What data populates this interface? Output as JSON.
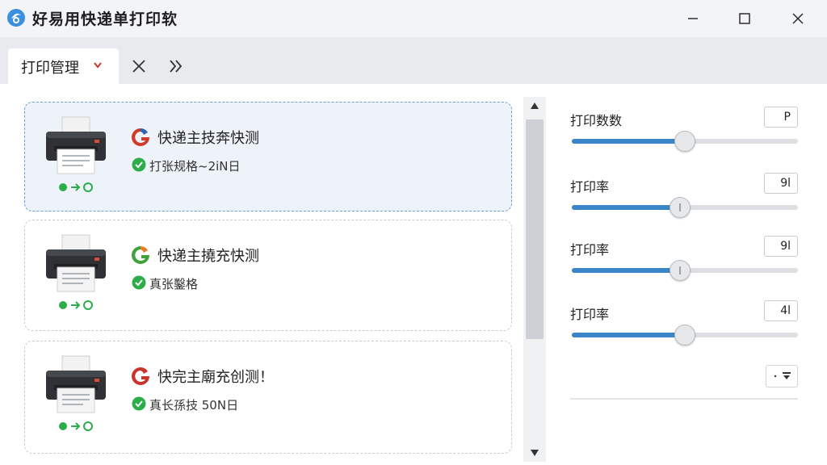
{
  "window": {
    "title": "好易用快递单打印软",
    "logo_icon": "app-logo-icon",
    "controls": [
      "minimize-icon",
      "maximize-icon",
      "close-icon"
    ]
  },
  "tabs": {
    "active_label": "打印管理",
    "active_caret_icon": "chevron-down-icon",
    "close_icon": "close-icon",
    "more_icon": "double-chevron-right-icon"
  },
  "jobs": [
    {
      "title": "快递主技奔快测",
      "subtitle": "打张规格~2iN日",
      "selected": true,
      "brand_color": "#d03a2a",
      "brand_accent": "#2a64b8",
      "check_color": "#2cad4a"
    },
    {
      "title": "快递主撓充快测",
      "subtitle": "真张鑿格",
      "selected": false,
      "brand_color": "#3fa23a",
      "brand_accent": "#e57c1f",
      "check_color": "#2cad4a"
    },
    {
      "title": "快完主廟充创测！",
      "subtitle": "真长孫技 50N日",
      "selected": false,
      "brand_color": "#c9352b",
      "brand_accent": "#c9352b",
      "check_color": "#2cad4a"
    }
  ],
  "settings": [
    {
      "label": "打印数数",
      "value": "P",
      "level": 0.5
    },
    {
      "label": "打印率",
      "value": "9l",
      "level": 0.48
    },
    {
      "label": "打印率",
      "value": "9l",
      "level": 0.48
    },
    {
      "label": "打印率",
      "value": "4l",
      "level": 0.5
    }
  ],
  "sort_control": {
    "icon": "sort-filter-icon"
  },
  "colors": {
    "accent": "#3b86c9",
    "selected_border": "#6a9fd6",
    "selected_bg": "#eef3f9",
    "status_green": "#2cad4a"
  }
}
